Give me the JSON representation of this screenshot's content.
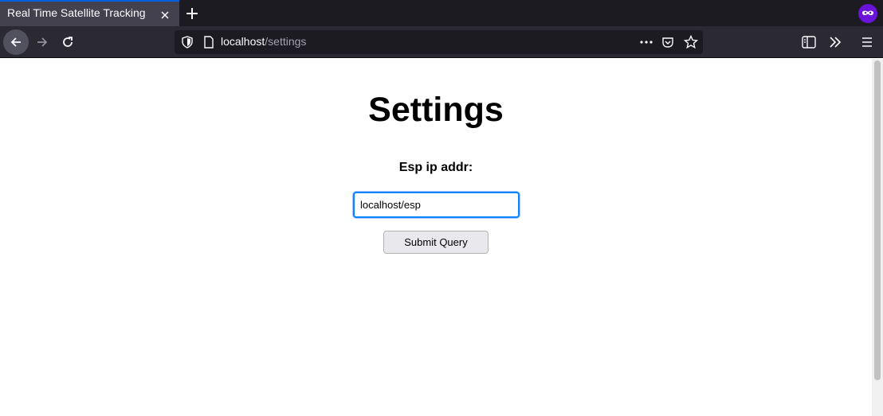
{
  "browser": {
    "tab_title": "Real Time Satellite Tracking",
    "url_host": "localhost",
    "url_path": "/settings"
  },
  "page": {
    "title": "Settings",
    "ip_label": "Esp ip addr:",
    "ip_value": "localhost/esp",
    "submit_label": "Submit Query"
  },
  "colors": {
    "accent": "#0a84ff",
    "profile": "#6b14d9"
  }
}
